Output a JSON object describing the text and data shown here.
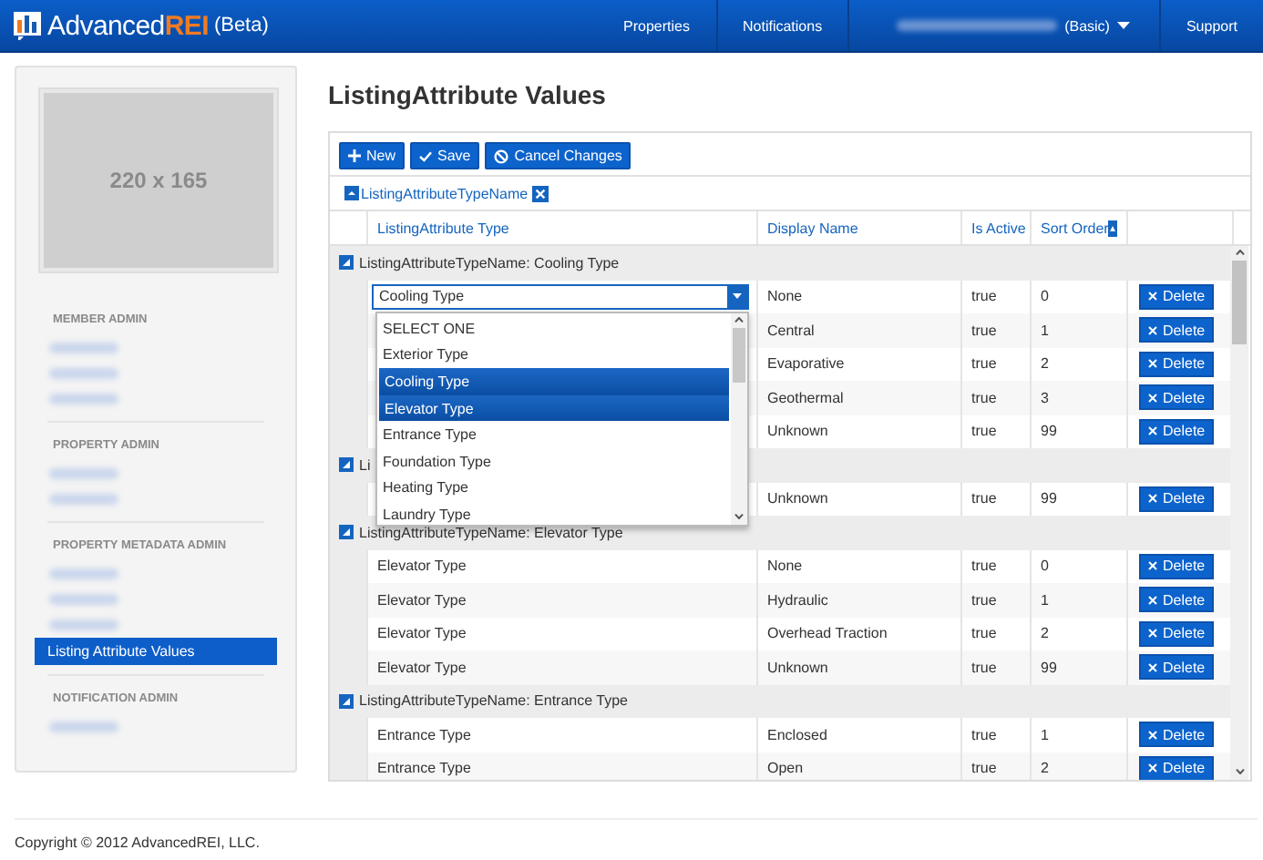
{
  "navbar": {
    "brand": "Advanced",
    "brand_accent": "REI",
    "brand_suffix": "(Beta)",
    "items": [
      {
        "kind": "link",
        "label": "Properties"
      },
      {
        "kind": "link",
        "label": "Notifications"
      },
      {
        "kind": "user",
        "label": "(Basic)"
      },
      {
        "kind": "link",
        "label": "Support"
      }
    ]
  },
  "sidebar": {
    "thumbnail": "220 x 165",
    "sections": [
      {
        "title": "MEMBER ADMIN",
        "items": [
          {
            "kind": "redacted"
          },
          {
            "kind": "redacted"
          },
          {
            "kind": "redacted"
          }
        ]
      },
      {
        "title": "PROPERTY ADMIN",
        "items": [
          {
            "kind": "redacted"
          },
          {
            "kind": "redacted"
          }
        ]
      },
      {
        "title": "PROPERTY METADATA ADMIN",
        "items": [
          {
            "kind": "redacted"
          },
          {
            "kind": "redacted"
          },
          {
            "kind": "redacted"
          },
          {
            "kind": "link",
            "label": "Listing Attribute Values",
            "selected": true
          }
        ]
      },
      {
        "title": "NOTIFICATION ADMIN",
        "items": [
          {
            "kind": "redacted"
          }
        ]
      }
    ]
  },
  "page_title": "ListingAttribute Values",
  "toolbar": [
    {
      "kind": "new",
      "label": "New"
    },
    {
      "kind": "save",
      "label": "Save"
    },
    {
      "kind": "cancel",
      "label": "Cancel Changes"
    }
  ],
  "group_chip": "ListingAttributeTypeName",
  "columns": [
    {
      "label": "ListingAttribute Type",
      "sorted": false
    },
    {
      "label": "Display Name",
      "sorted": false
    },
    {
      "label": "Is Active",
      "sorted": false
    },
    {
      "label": "Sort Order",
      "sorted": true
    }
  ],
  "groups": [
    {
      "label": "ListingAttributeTypeName: Cooling Type",
      "expanded": true,
      "rows": [
        {
          "kind": "edit",
          "type": "Cooling Type",
          "display": "None",
          "active": "true",
          "sort": "0",
          "action": "Delete"
        },
        {
          "kind": "covered",
          "display": "Central",
          "active": "true",
          "sort": "1",
          "action": "Delete"
        },
        {
          "kind": "covered",
          "display": "Evaporative",
          "active": "true",
          "sort": "2",
          "action": "Delete"
        },
        {
          "kind": "covered",
          "display": "Geothermal",
          "active": "true",
          "sort": "3",
          "action": "Delete"
        },
        {
          "kind": "covered",
          "display": "Unknown",
          "active": "true",
          "sort": "99",
          "action": "Delete"
        }
      ]
    },
    {
      "label": "Li",
      "expanded": true,
      "rows": [
        {
          "kind": "covered",
          "display": "Unknown",
          "active": "true",
          "sort": "99",
          "action": "Delete"
        }
      ]
    },
    {
      "label": "ListingAttributeTypeName: Elevator Type",
      "expanded": true,
      "rows": [
        {
          "kind": "plain",
          "type": "Elevator Type",
          "display": "None",
          "active": "true",
          "sort": "0",
          "action": "Delete"
        },
        {
          "kind": "plain",
          "type": "Elevator Type",
          "display": "Hydraulic",
          "active": "true",
          "sort": "1",
          "action": "Delete"
        },
        {
          "kind": "plain",
          "type": "Elevator Type",
          "display": "Overhead Traction",
          "active": "true",
          "sort": "2",
          "action": "Delete"
        },
        {
          "kind": "plain",
          "type": "Elevator Type",
          "display": "Unknown",
          "active": "true",
          "sort": "99",
          "action": "Delete"
        }
      ]
    },
    {
      "label": "ListingAttributeTypeName: Entrance Type",
      "expanded": true,
      "rows": [
        {
          "kind": "plain",
          "type": "Entrance Type",
          "display": "Enclosed",
          "active": "true",
          "sort": "1",
          "action": "Delete"
        },
        {
          "kind": "plain",
          "type": "Entrance Type",
          "display": "Open",
          "active": "true",
          "sort": "2",
          "action": "Delete"
        }
      ]
    }
  ],
  "dropdown_options": [
    {
      "label": "SELECT ONE",
      "selected": false
    },
    {
      "label": "Exterior Type",
      "selected": false
    },
    {
      "label": "Cooling Type",
      "selected": true
    },
    {
      "label": "Elevator Type",
      "selected": true
    },
    {
      "label": "Entrance Type",
      "selected": false
    },
    {
      "label": "Foundation Type",
      "selected": false
    },
    {
      "label": "Heating Type",
      "selected": false
    },
    {
      "label": "Laundry Type",
      "selected": false
    }
  ],
  "footer": "Copyright © 2012 AdvancedREI, LLC."
}
